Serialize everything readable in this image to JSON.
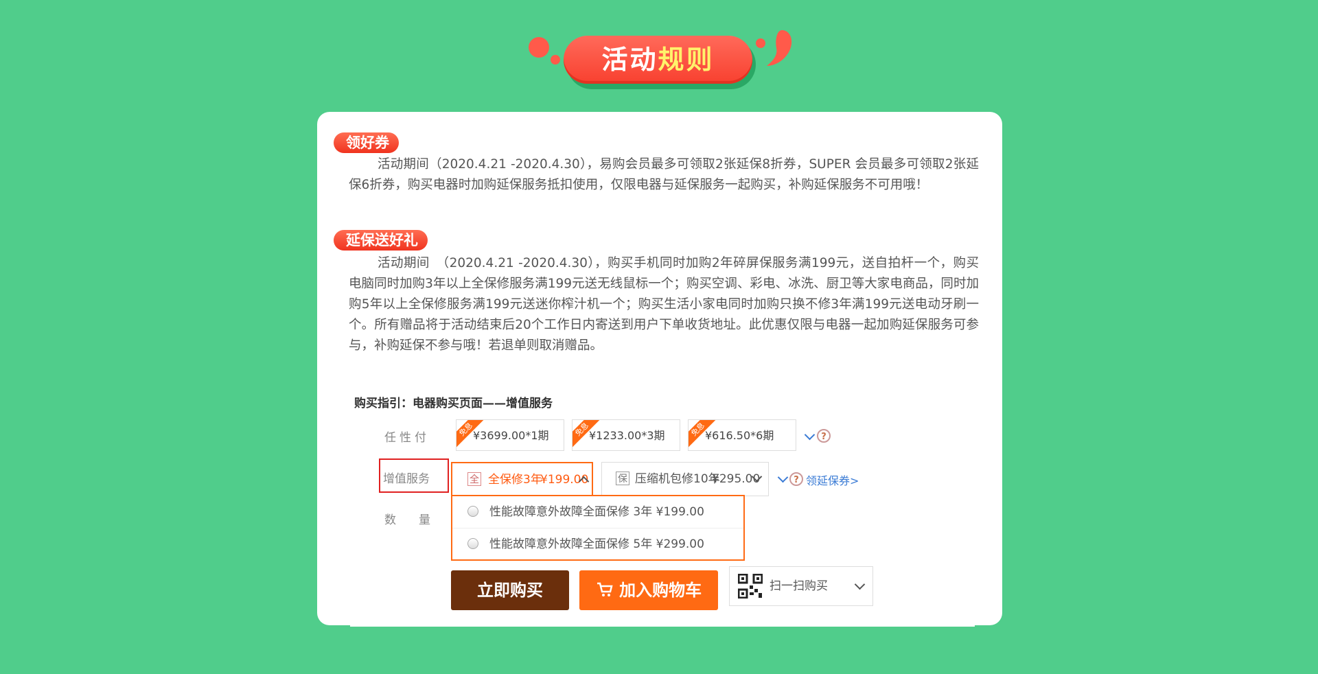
{
  "banner": {
    "title_part1": "活动",
    "title_part2": "规则"
  },
  "sections": [
    {
      "tag": "领好券",
      "text": "活动期间（2020.4.21 -2020.4.30），易购会员最多可领取2张延保8折券，SUPER 会员最多可领取2张延保6折券，购买电器时加购延保服务抵扣使用，仅限电器与延保服务一起购买，补购延保服务不可用哦！"
    },
    {
      "tag": "延保送好礼",
      "text": "活动期间　（2020.4.21 -2020.4.30），购买手机同时加购2年碎屏保服务满199元，送自拍杆一个，购买电脑同时加购3年以上全保修服务满199元送无线鼠标一个；购买空调、彩电、冰洗、厨卫等大家电商品，同时加购5年以上全保修服务满199元送迷你榨汁机一个；购买生活小家电同时加购只换不修3年满199元送电动牙刷一个。所有赠品将于活动结束后20个工作日内寄送到用户下单收货地址。此优惠仅限与电器一起加购延保服务可参与，补购延保不参与哦！若退单则取消赠品。"
    }
  ],
  "guide": {
    "title": "购买指引：电器购买页面——增值服务",
    "labels": {
      "installment": "任性付",
      "value_service": "增值服务",
      "quantity": "数　量"
    },
    "installments": [
      {
        "ribbon": "免息",
        "price": "¥3699.00*1期"
      },
      {
        "ribbon": "免息",
        "price": "¥1233.00*3期"
      },
      {
        "ribbon": "免息",
        "price": "¥616.50*6期"
      }
    ],
    "qmark": "?",
    "services": [
      {
        "icon": "全",
        "label": "全保修3年",
        "price": "¥199.00"
      },
      {
        "icon": "保",
        "label": "压缩机包修10年",
        "price": "¥295.00"
      }
    ],
    "coupon_link": "领延保券>",
    "options": [
      {
        "label": "性能故障意外故障全面保修",
        "term": "3年",
        "price": "¥199.00"
      },
      {
        "label": "性能故障意外故障全面保修",
        "term": "5年",
        "price": "¥299.00"
      }
    ],
    "buy_now": "立即购买",
    "add_cart": "加入购物车",
    "scan_buy": "扫一扫购买"
  },
  "colors": {
    "background": "#50cd8b",
    "tag_red": "#f0331f",
    "buy_now_bg": "#6b2f0c",
    "add_cart_bg": "#ff6a13",
    "link_blue": "#3a7bd5"
  }
}
